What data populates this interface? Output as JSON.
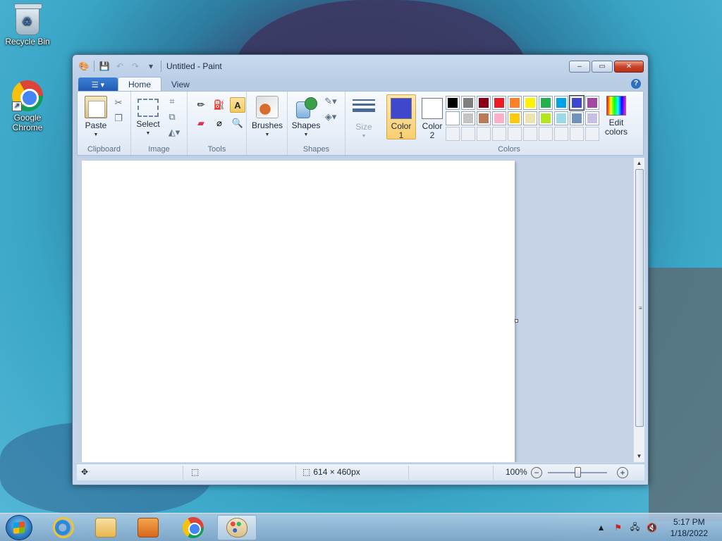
{
  "desktop": {
    "icons": [
      {
        "label": "Recycle Bin"
      },
      {
        "label": "Google Chrome"
      }
    ]
  },
  "window": {
    "title": "Untitled - Paint",
    "controls": {
      "minimize": "‒",
      "maximize": "▭",
      "close": "✕"
    }
  },
  "ribbon": {
    "tabs": [
      "Home",
      "View"
    ],
    "groups": {
      "clipboard": {
        "label": "Clipboard",
        "paste": "Paste"
      },
      "image": {
        "label": "Image",
        "select": "Select"
      },
      "tools": {
        "label": "Tools"
      },
      "brushes": {
        "label": "Brushes"
      },
      "shapes": {
        "label": "Shapes",
        "shapes_btn": "Shapes"
      },
      "size": {
        "label": "Size"
      },
      "colors": {
        "label": "Colors",
        "color1": {
          "label_line1": "Color",
          "label_line2": "1",
          "value": "#3f48cc"
        },
        "color2": {
          "label_line1": "Color",
          "label_line2": "2",
          "value": "#ffffff"
        },
        "edit_line1": "Edit",
        "edit_line2": "colors",
        "palette_row1": [
          "#000000",
          "#7f7f7f",
          "#880015",
          "#ed1c24",
          "#ff7f27",
          "#fff200",
          "#22b14c",
          "#00a2e8",
          "#3f48cc",
          "#a349a4"
        ],
        "palette_row2": [
          "#ffffff",
          "#c3c3c3",
          "#b97a57",
          "#ffaec9",
          "#ffc90e",
          "#efe4b0",
          "#b5e61d",
          "#99d9ea",
          "#7092be",
          "#c8bfe7"
        ]
      }
    }
  },
  "canvas": {
    "background": "#ffffff"
  },
  "statusbar": {
    "size": "614 × 460px",
    "zoom": "100%"
  },
  "taskbar": {
    "clock_time": "5:17 PM",
    "clock_date": "1/18/2022"
  }
}
